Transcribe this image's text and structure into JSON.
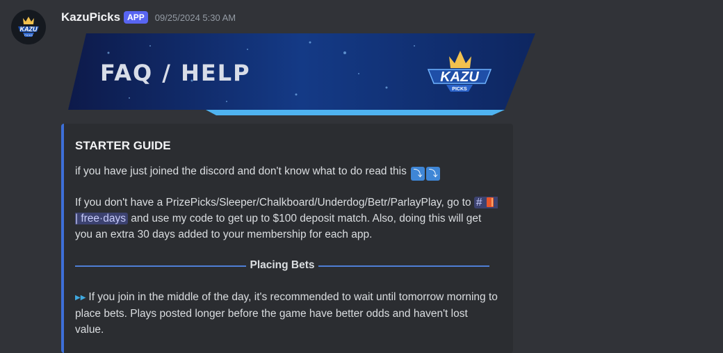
{
  "message": {
    "username": "KazuPicks",
    "badge": "APP",
    "timestamp": "09/25/2024 5:30 AM"
  },
  "banner": {
    "title": "FAQ / HELP",
    "logo_text": "KAZU",
    "logo_subtext": "PICKS"
  },
  "avatar": {
    "logo_text": "KAZU",
    "logo_subtext": "PICKS"
  },
  "embed": {
    "accent_color": "#3d6fd8",
    "title": "STARTER GUIDE",
    "p1_text": "if you have just joined the discord and don't know what to do read this",
    "p1_emoji": "⤵",
    "p2_before": "If you don't have a PrizePicks/Sleeper/Chalkboard/Underdog/Betr/ParlayPlay, go to",
    "channel_hash": "#",
    "channel_name": "| free·days",
    "p2_after": "and use my code to get up to $100 deposit match. Also, doing this will get you an extra 30 days added to your membership for each app.",
    "divider_label": "Placing Bets",
    "p3_text": "If you join in the middle of the day, it's recommended to wait until tomorrow morning to place bets. Plays posted longer before the game have better odds and haven't lost value.",
    "p3_icon": "fast-forward-icon"
  }
}
